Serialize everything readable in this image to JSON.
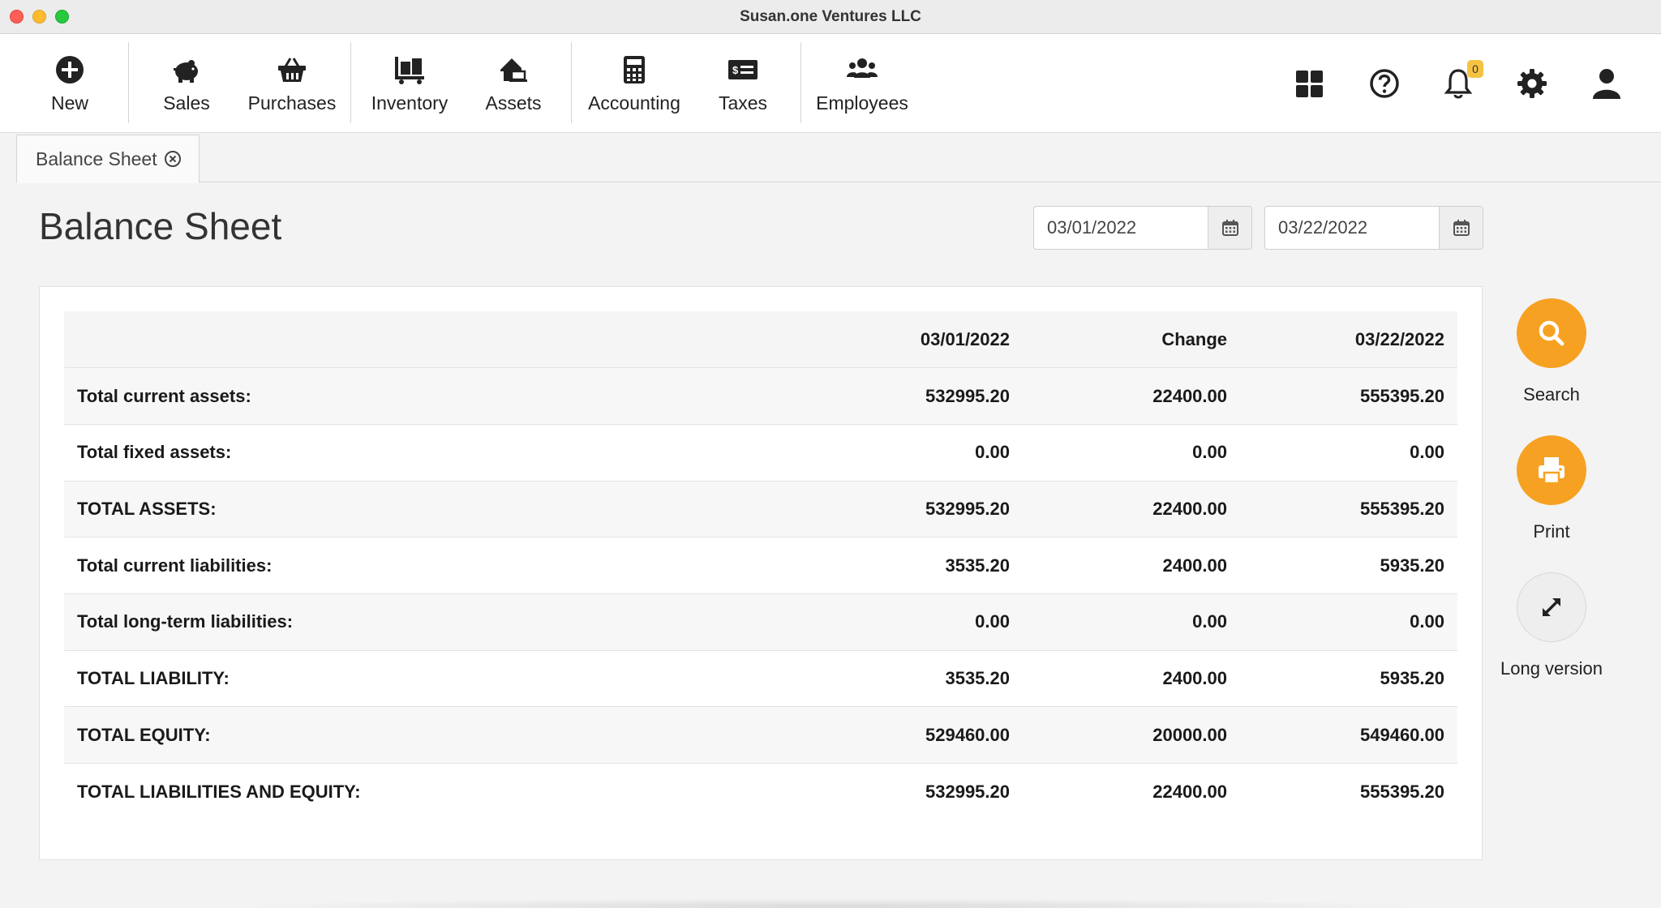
{
  "window": {
    "title": "Susan.one Ventures LLC"
  },
  "nav": {
    "items": [
      {
        "label": "New",
        "icon": "plus-circle-icon"
      },
      {
        "label": "Sales",
        "icon": "piggy-bank-icon"
      },
      {
        "label": "Purchases",
        "icon": "basket-icon"
      },
      {
        "label": "Inventory",
        "icon": "dolly-boxes-icon"
      },
      {
        "label": "Assets",
        "icon": "house-laptop-icon"
      },
      {
        "label": "Accounting",
        "icon": "calculator-icon"
      },
      {
        "label": "Taxes",
        "icon": "money-check-icon"
      },
      {
        "label": "Employees",
        "icon": "users-icon"
      }
    ],
    "right_icons": [
      "dashboard-grid-icon",
      "help-icon",
      "bell-icon",
      "gear-icon",
      "user-icon"
    ],
    "notification_count": "0"
  },
  "tabs": [
    {
      "label": "Balance Sheet"
    }
  ],
  "page": {
    "title": "Balance Sheet",
    "date_from": "03/01/2022",
    "date_to": "03/22/2022"
  },
  "report": {
    "headers": [
      "",
      "03/01/2022",
      "Change",
      "03/22/2022"
    ],
    "rows": [
      {
        "label": "Total current assets:",
        "start": "532995.20",
        "change": "22400.00",
        "end": "555395.20"
      },
      {
        "label": "Total fixed assets:",
        "start": "0.00",
        "change": "0.00",
        "end": "0.00"
      },
      {
        "label": "TOTAL ASSETS:",
        "start": "532995.20",
        "change": "22400.00",
        "end": "555395.20"
      },
      {
        "label": "Total current liabilities:",
        "start": "3535.20",
        "change": "2400.00",
        "end": "5935.20"
      },
      {
        "label": "Total long-term liabilities:",
        "start": "0.00",
        "change": "0.00",
        "end": "0.00"
      },
      {
        "label": "TOTAL LIABILITY:",
        "start": "3535.20",
        "change": "2400.00",
        "end": "5935.20"
      },
      {
        "label": "TOTAL EQUITY:",
        "start": "529460.00",
        "change": "20000.00",
        "end": "549460.00"
      },
      {
        "label": "TOTAL LIABILITIES AND EQUITY:",
        "start": "532995.20",
        "change": "22400.00",
        "end": "555395.20"
      }
    ]
  },
  "actions": {
    "search_label": "Search",
    "print_label": "Print",
    "long_label": "Long version"
  },
  "colors": {
    "accent": "#f7a123",
    "badge": "#f5c242"
  }
}
